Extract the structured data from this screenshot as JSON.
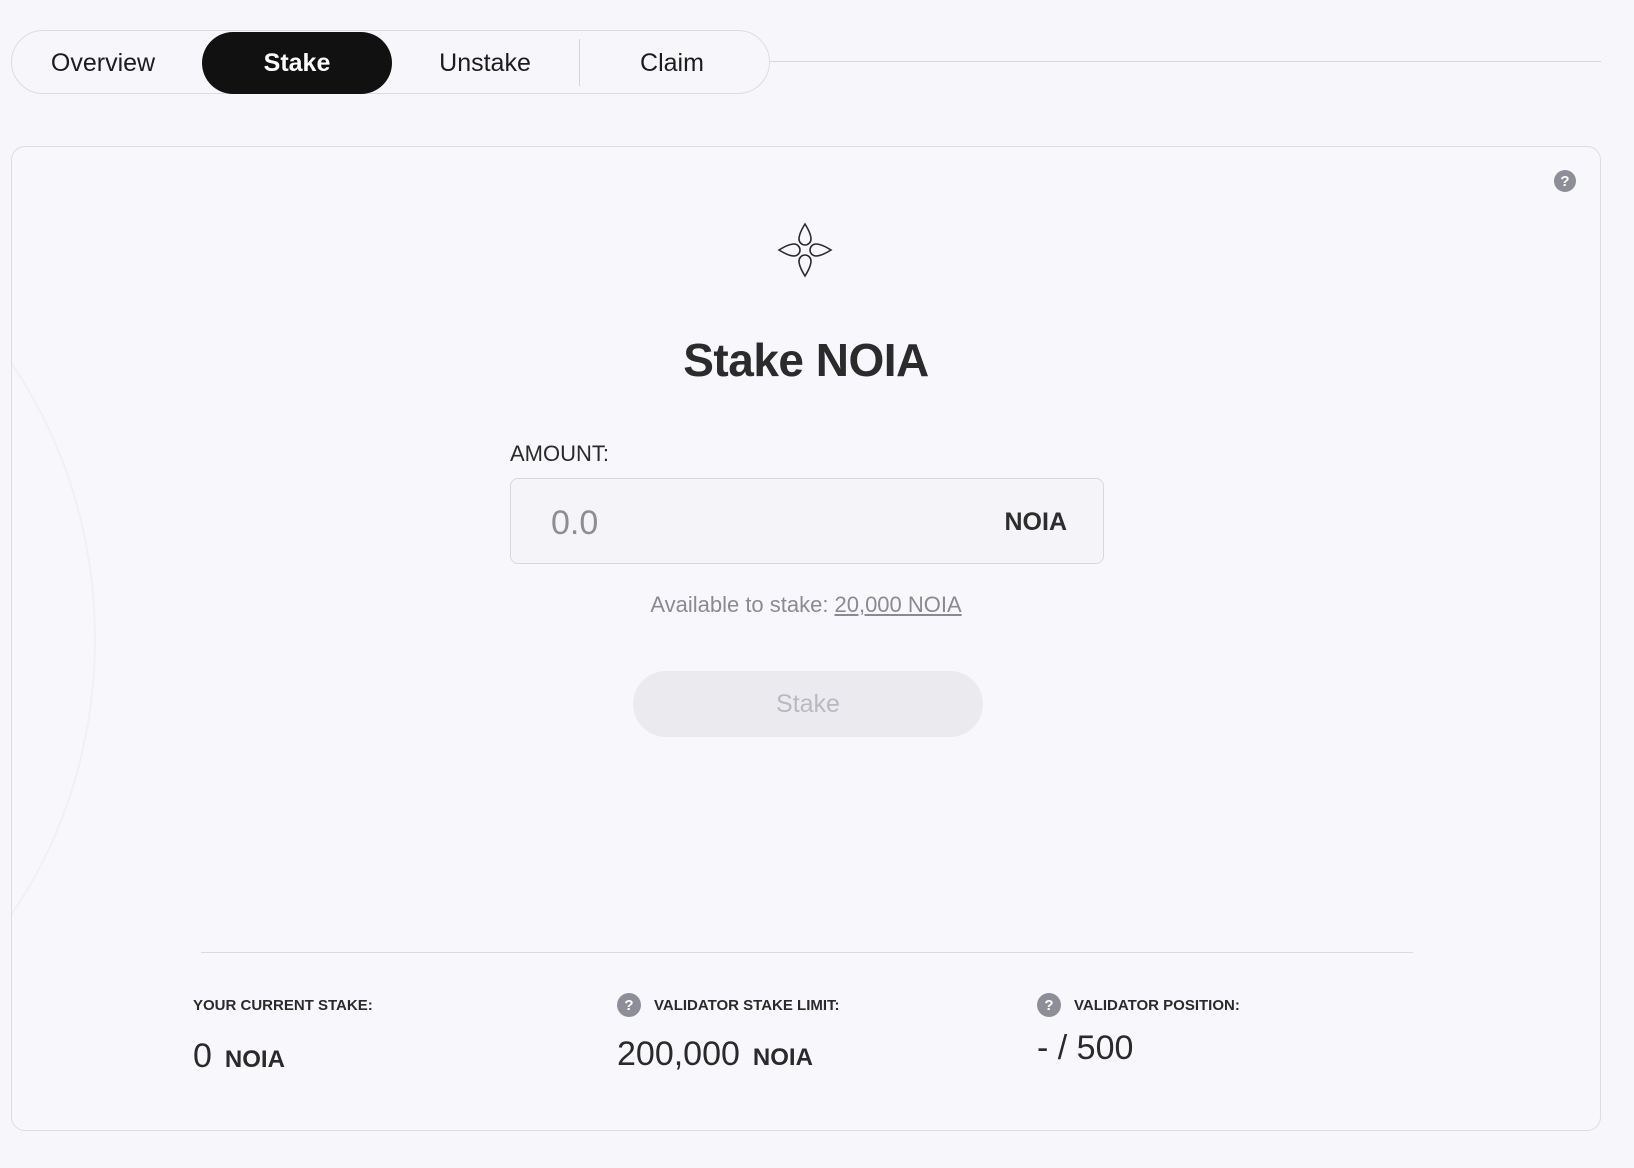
{
  "tabs": [
    {
      "label": "Overview",
      "active": false
    },
    {
      "label": "Stake",
      "active": true
    },
    {
      "label": "Unstake",
      "active": false
    },
    {
      "label": "Claim",
      "active": false
    }
  ],
  "card": {
    "help_icon": "question-icon",
    "logo_icon": "four-petal-logo-icon",
    "title": "Stake NOIA",
    "amount": {
      "label": "AMOUNT:",
      "placeholder": "0.0",
      "value": "",
      "unit": "NOIA"
    },
    "available": {
      "label": "Available to stake:",
      "value": "20,000 NOIA"
    },
    "stake_button": {
      "label": "Stake",
      "disabled": true
    }
  },
  "stats": [
    {
      "label": "YOUR CURRENT STAKE:",
      "value": "0",
      "unit": "NOIA",
      "help": false
    },
    {
      "label": "VALIDATOR STAKE LIMIT:",
      "value": "200,000",
      "unit": "NOIA",
      "help": true
    },
    {
      "label": "VALIDATOR POSITION:",
      "value": "- / 500",
      "unit": "",
      "help": true
    }
  ],
  "colors": {
    "background": "#f7f7fb",
    "active_tab": "#111111",
    "disabled_button": "#ebebef",
    "muted_text": "#8a8a90"
  }
}
